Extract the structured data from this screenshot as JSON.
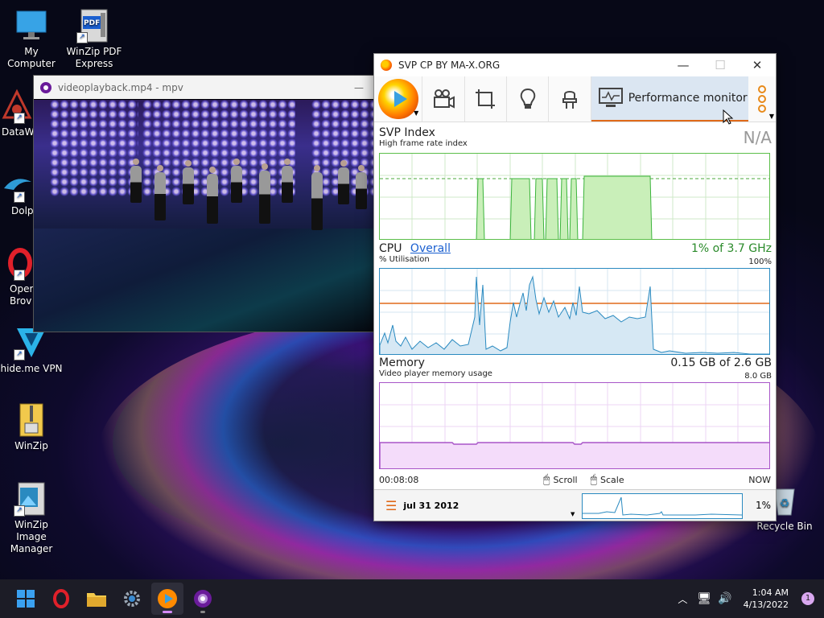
{
  "desktop": {
    "icons": [
      {
        "label": "My Computer"
      },
      {
        "label": "WinZip PDF Express"
      },
      {
        "label": "DataWa"
      },
      {
        "label": "Dolp"
      },
      {
        "label": "Oper Brov"
      },
      {
        "label": "hide.me VPN"
      },
      {
        "label": "WinZip"
      },
      {
        "label": "WinZip Image Manager"
      },
      {
        "label": "Recycle Bin"
      }
    ],
    "pdf_badge": "PDF"
  },
  "mpv": {
    "title": "videoplayback.mp4 - mpv",
    "minimize": "—"
  },
  "svp": {
    "title": "SVP CP BY MA-X.ORG",
    "winbtns": {
      "minimize": "—",
      "maximize": "☐",
      "close": "✕"
    },
    "toolbar": {
      "perf_label": "Performance monitor"
    },
    "svp_index": {
      "title": "SVP Index",
      "subtitle": "High frame rate index",
      "value": "N/A"
    },
    "cpu": {
      "title": "CPU",
      "link": "Overall",
      "value": "1% of 3.7 GHz",
      "subtitle": "% Utilisation",
      "max": "100%"
    },
    "memory": {
      "title": "Memory",
      "value": "0.15 GB of 2.6 GB",
      "subtitle": "Video player memory usage",
      "max": "8.0 GB"
    },
    "footer": {
      "time": "00:08:08",
      "scroll": "Scroll",
      "scale": "Scale",
      "now": "NOW"
    },
    "status": {
      "date": "jul 31 2012",
      "percent": "1%"
    }
  },
  "taskbar": {
    "clock_time": "1:04 AM",
    "clock_date": "4/13/2022",
    "notifications": "1"
  },
  "colors": {
    "accent": "#e06a1a",
    "svp_graph": "#3cb43c",
    "cpu_graph": "#2a8ac0",
    "mem_graph": "#a855c8"
  }
}
